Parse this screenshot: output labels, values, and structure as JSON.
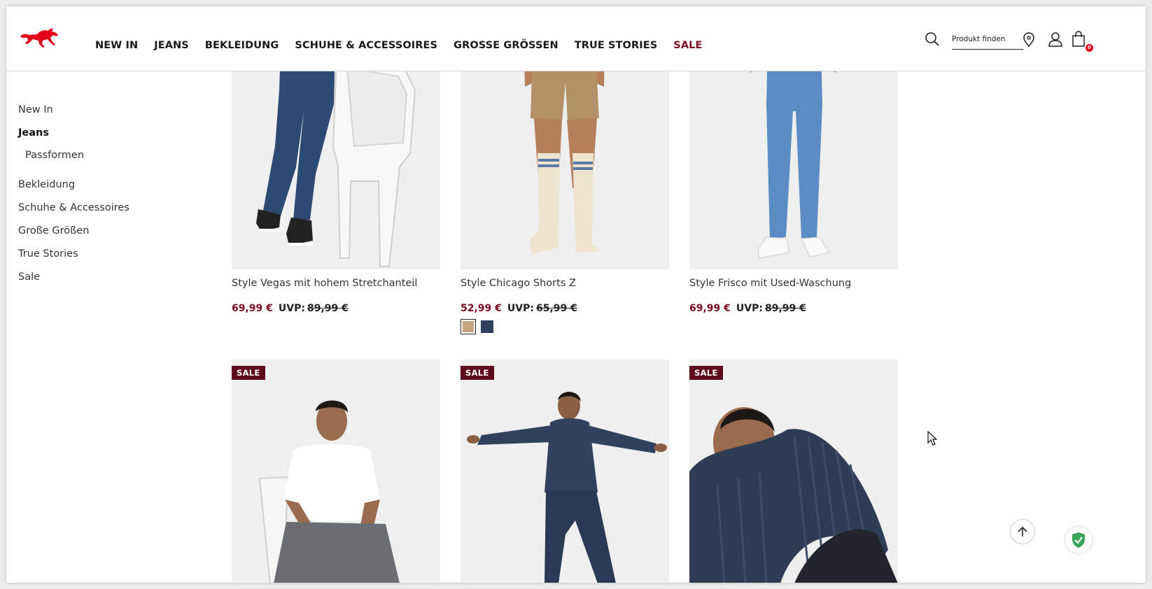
{
  "header": {
    "logo": "mustang-horse-logo",
    "nav": [
      "NEW IN",
      "JEANS",
      "BEKLEIDUNG",
      "SCHUHE & ACCESSOIRES",
      "GROSSE GRÖSSEN",
      "TRUE STORIES",
      "SALE"
    ],
    "search_placeholder": "Produkt finden",
    "cart_count": "0"
  },
  "sidebar": {
    "items": [
      {
        "label": "New In",
        "active": false
      },
      {
        "label": "Jeans",
        "active": true
      },
      {
        "label": "Passformen",
        "sub": true
      },
      {
        "label": "Bekleidung"
      },
      {
        "label": "Schuhe & Accessoires"
      },
      {
        "label": "Große Größen"
      },
      {
        "label": "True Stories"
      },
      {
        "label": "Sale"
      }
    ]
  },
  "products_row1": [
    {
      "title": "Style Vegas mit hohem Stretchanteil",
      "price": "69,99 €",
      "uvp_label": "UVP:",
      "old_price": "89,99 €"
    },
    {
      "title": "Style Chicago Shorts Z",
      "price": "52,99 €",
      "uvp_label": "UVP:",
      "old_price": "65,99 €",
      "swatches": [
        "#c7a57e",
        "#2f3f5c"
      ]
    },
    {
      "title": "Style Frisco mit Used-Waschung",
      "price": "69,99 €",
      "uvp_label": "UVP:",
      "old_price": "89,99 €"
    }
  ],
  "products_row2": [
    {
      "badge": "SALE"
    },
    {
      "badge": "SALE"
    },
    {
      "badge": "SALE"
    }
  ],
  "colors": {
    "sale_red": "#7d0d24",
    "badge_bg": "#5e0a1d",
    "logo_red": "#e2001a"
  }
}
